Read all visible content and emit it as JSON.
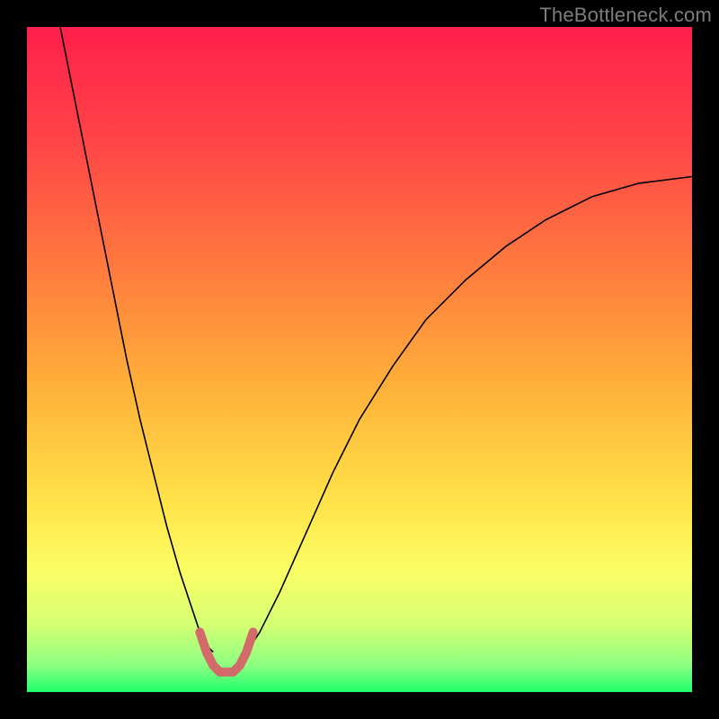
{
  "watermark": "TheBottleneck.com",
  "chart_data": {
    "type": "line",
    "title": "",
    "xlabel": "",
    "ylabel": "",
    "xlim": [
      0,
      100
    ],
    "ylim": [
      0,
      100
    ],
    "gradient_stops": [
      {
        "offset": 0.0,
        "color": "#ff1f4b"
      },
      {
        "offset": 0.18,
        "color": "#ff4747"
      },
      {
        "offset": 0.36,
        "color": "#ff7a3e"
      },
      {
        "offset": 0.55,
        "color": "#ffb33a"
      },
      {
        "offset": 0.72,
        "color": "#ffe44a"
      },
      {
        "offset": 0.82,
        "color": "#fbff66"
      },
      {
        "offset": 0.9,
        "color": "#d4ff74"
      },
      {
        "offset": 0.96,
        "color": "#8cff82"
      },
      {
        "offset": 1.0,
        "color": "#1fff6a"
      }
    ],
    "series": [
      {
        "name": "left-branch",
        "color": "#000000",
        "width": 1.6,
        "x": [
          5,
          7,
          9,
          11,
          13,
          15,
          17,
          19,
          21,
          23,
          25,
          26,
          27,
          28
        ],
        "y": [
          100,
          90,
          80,
          70,
          60,
          50,
          41,
          33,
          25,
          18,
          12,
          9,
          7,
          6
        ]
      },
      {
        "name": "right-branch",
        "color": "#000000",
        "width": 1.6,
        "x": [
          33,
          35,
          38,
          42,
          46,
          50,
          55,
          60,
          66,
          72,
          78,
          85,
          92,
          100
        ],
        "y": [
          6,
          9,
          15,
          24,
          33,
          41,
          49,
          56,
          62,
          67,
          71,
          74.5,
          76.5,
          77.5
        ]
      },
      {
        "name": "valley-highlight",
        "color": "#d36a6a",
        "width": 10,
        "linecap": "round",
        "x": [
          26,
          27,
          28,
          29,
          30,
          31,
          32,
          33,
          34
        ],
        "y": [
          9,
          6,
          4,
          3,
          3,
          3,
          4,
          6,
          9
        ]
      }
    ]
  }
}
